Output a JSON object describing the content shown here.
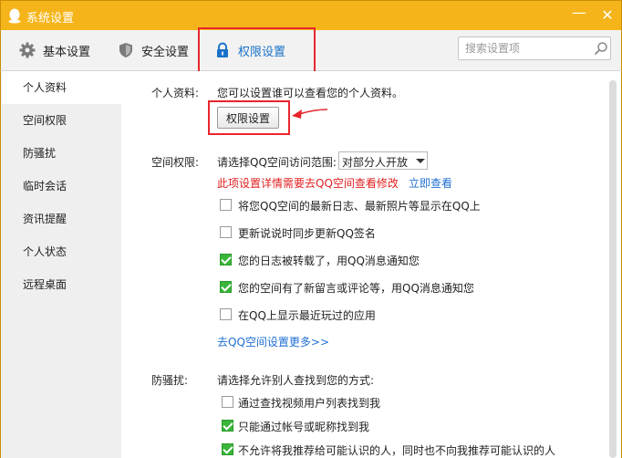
{
  "window": {
    "title": "系统设置",
    "minimize_glyph": "—",
    "close_glyph": "✕"
  },
  "tabs": [
    {
      "label": "基本设置",
      "icon": "gear-icon"
    },
    {
      "label": "安全设置",
      "icon": "shield-icon"
    },
    {
      "label": "权限设置",
      "icon": "lock-icon",
      "active": true
    }
  ],
  "search": {
    "placeholder": "搜索设置项"
  },
  "sidebar": {
    "items": [
      {
        "label": "个人资料",
        "active": true
      },
      {
        "label": "空间权限"
      },
      {
        "label": "防骚扰"
      },
      {
        "label": "临时会话"
      },
      {
        "label": "资讯提醒"
      },
      {
        "label": "个人状态"
      },
      {
        "label": "远程桌面"
      }
    ]
  },
  "profile": {
    "label": "个人资料:",
    "desc": "您可以设置谁可以查看您的个人资料。",
    "button": "权限设置"
  },
  "space": {
    "label": "空间权限:",
    "prompt": "请选择QQ空间访问范围:",
    "select_value": "对部分人开放",
    "warning": "此项设置详情需要去QQ空间查看修改",
    "view_link": "立即查看",
    "options": [
      {
        "label": "将您QQ空间的最新日志、最新照片等显示在QQ上",
        "checked": false
      },
      {
        "label": "更新说说时同步更新QQ签名",
        "checked": false
      },
      {
        "label": "您的日志被转载了，用QQ消息通知您",
        "checked": true
      },
      {
        "label": "您的空间有了新留言或评论等，用QQ消息通知您",
        "checked": true
      },
      {
        "label": "在QQ上显示最近玩过的应用",
        "checked": false
      }
    ],
    "more_link": "去QQ空间设置更多>>"
  },
  "harass": {
    "label": "防骚扰:",
    "prompt": "请选择允许别人查找到您的方式:",
    "options": [
      {
        "label": "通过查找视频用户列表找到我",
        "checked": false
      },
      {
        "label": "只能通过帐号或昵称找到我",
        "checked": true
      },
      {
        "label": "不允许将我推荐给可能认识的人，同时也不向我推荐可能认识的人",
        "checked": true
      }
    ]
  },
  "colors": {
    "titlebar": "#f5b51a",
    "accent": "#1a73c9",
    "highlight": "#e8262c",
    "warning": "#e02020",
    "checkbox": "#3ab53a"
  }
}
